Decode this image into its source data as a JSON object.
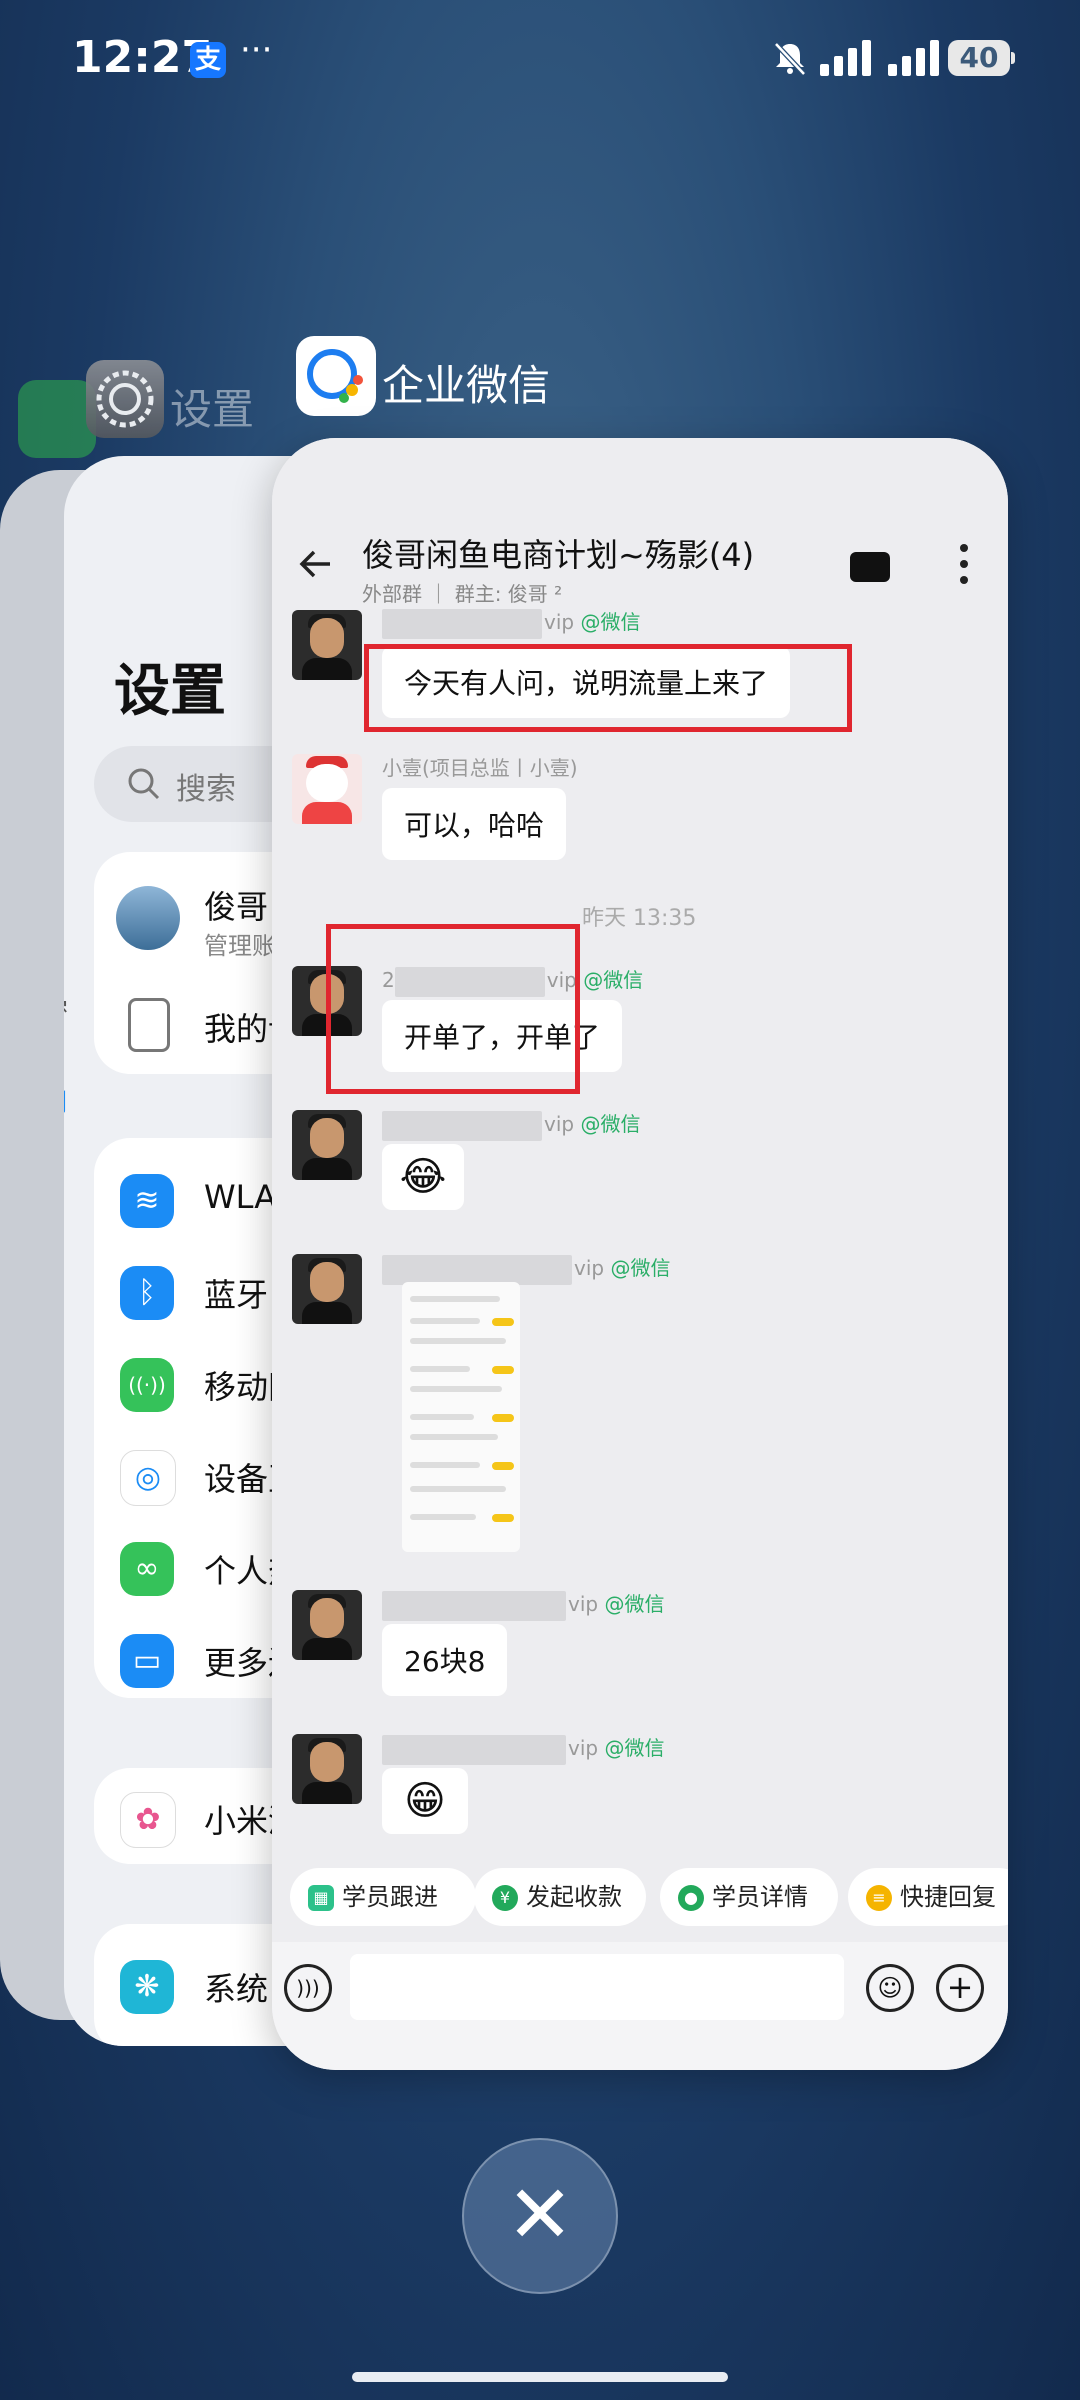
{
  "status_bar": {
    "time": "12:27",
    "alipay_badge": "支",
    "more": "···",
    "battery": "40"
  },
  "recents": {
    "settings_app_label": "设置",
    "wecom_app_label": "企业微信",
    "close_symbol": "✕"
  },
  "settings_card": {
    "title": "设置",
    "search_placeholder": "搜索",
    "account": {
      "name": "俊哥",
      "sub": "管理账"
    },
    "my_device": "我的设",
    "side_labels": [
      "密",
      "用"
    ],
    "rows": [
      {
        "label": "WLAN",
        "color": "#1b8cf5",
        "icon": "wifi-icon",
        "glyph": "≋"
      },
      {
        "label": "蓝牙",
        "color": "#1b8cf5",
        "icon": "bluetooth-icon",
        "glyph": "ᛒ"
      },
      {
        "label": "移动网",
        "color": "#35c25a",
        "icon": "mobile-network-icon",
        "glyph": "((·))"
      },
      {
        "label": "设备互",
        "color": "#ffffff",
        "icon": "device-connect-icon",
        "glyph": "◎"
      },
      {
        "label": "个人热",
        "color": "#35c25a",
        "icon": "hotspot-icon",
        "glyph": "∞"
      },
      {
        "label": "更多连",
        "color": "#1b8cf5",
        "icon": "more-connect-icon",
        "glyph": "▭"
      }
    ],
    "xiaomi": "小米澎",
    "system": "系统"
  },
  "chat": {
    "title": "俊哥闲鱼电商计划~殇影(4)",
    "subtitle": "外部群 ｜ 群主: 俊哥 ²",
    "timestamp": "昨天 13:35",
    "messages": [
      {
        "name_suffix": "vip",
        "wx_tag": "@微信",
        "text": "今天有人问，说明流量上来了"
      },
      {
        "name": "小壹(项目总监丨小壹)",
        "text": "可以，哈哈"
      },
      {
        "name_prefix": "2",
        "name_suffix": "vip",
        "wx_tag": "@微信",
        "text": "开单了，开单了"
      },
      {
        "name_suffix": "vip",
        "wx_tag": "@微信",
        "emoji": "😂"
      },
      {
        "name_suffix": "vip",
        "wx_tag": "@微信",
        "image": "screenshot"
      },
      {
        "name_suffix": "vip",
        "wx_tag": "@微信",
        "text": "26块8"
      },
      {
        "name_suffix": "vip",
        "wx_tag": "@微信",
        "emoji": "😁"
      }
    ],
    "quick_actions": [
      "学员跟进",
      "发起收款",
      "学员详情",
      "快捷回复"
    ]
  }
}
